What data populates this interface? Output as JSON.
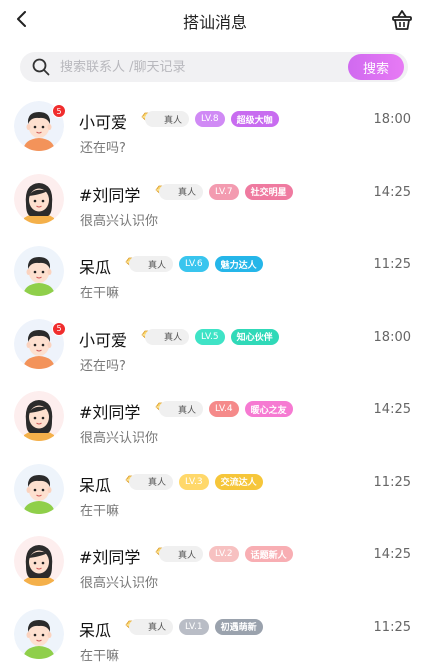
{
  "header": {
    "title": "搭讪消息"
  },
  "search": {
    "placeholder": "搜索联系人 /聊天记录",
    "button_label": "搜索"
  },
  "items": [
    {
      "name": "小可爱",
      "avatar": "boy",
      "unread": "5",
      "real_label": "真人",
      "level": "LV.8",
      "level_color": "#d08af5",
      "tag": "超级大咖",
      "tag_color": "#c86cf0",
      "time": "18:00",
      "message": "还在吗?"
    },
    {
      "name": "#刘同学",
      "avatar": "girl",
      "unread": "",
      "real_label": "真人",
      "level": "LV.7",
      "level_color": "#f39bb0",
      "tag": "社交明星",
      "tag_color": "#ef7aa0",
      "time": "14:25",
      "message": "很高兴认识你"
    },
    {
      "name": "呆瓜",
      "avatar": "boy-green",
      "unread": "",
      "real_label": "真人",
      "level": "LV.6",
      "level_color": "#39c5ee",
      "tag": "魅力达人",
      "tag_color": "#25b6e9",
      "time": "11:25",
      "message": "在干嘛"
    },
    {
      "name": "小可爱",
      "avatar": "boy",
      "unread": "5",
      "real_label": "真人",
      "level": "LV.5",
      "level_color": "#3fe3c6",
      "tag": "知心伙伴",
      "tag_color": "#30d9b8",
      "time": "18:00",
      "message": "还在吗?"
    },
    {
      "name": "#刘同学",
      "avatar": "girl",
      "unread": "",
      "real_label": "真人",
      "level": "LV.4",
      "level_color": "#f58a8a",
      "tag": "暖心之友",
      "tag_color": "#f67ad2",
      "time": "14:25",
      "message": "很高兴认识你"
    },
    {
      "name": "呆瓜",
      "avatar": "boy-green",
      "unread": "",
      "real_label": "真人",
      "level": "LV.3",
      "level_color": "#ffd86a",
      "tag": "交流达人",
      "tag_color": "#f6c63a",
      "time": "11:25",
      "message": "在干嘛"
    },
    {
      "name": "#刘同学",
      "avatar": "girl",
      "unread": "",
      "real_label": "真人",
      "level": "LV.2",
      "level_color": "#f7c1c1",
      "tag": "话题新人",
      "tag_color": "#f8aeb3",
      "time": "14:25",
      "message": "很高兴认识你"
    },
    {
      "name": "呆瓜",
      "avatar": "boy-green",
      "unread": "",
      "real_label": "真人",
      "level": "LV.1",
      "level_color": "#b9bdc6",
      "tag": "初遇萌新",
      "tag_color": "#9aa2ad",
      "time": "11:25",
      "message": "在干嘛"
    }
  ],
  "icons": {
    "back": "chevron-left-icon",
    "basket": "basket-icon",
    "search": "search-icon",
    "diamond": "diamond-icon"
  }
}
